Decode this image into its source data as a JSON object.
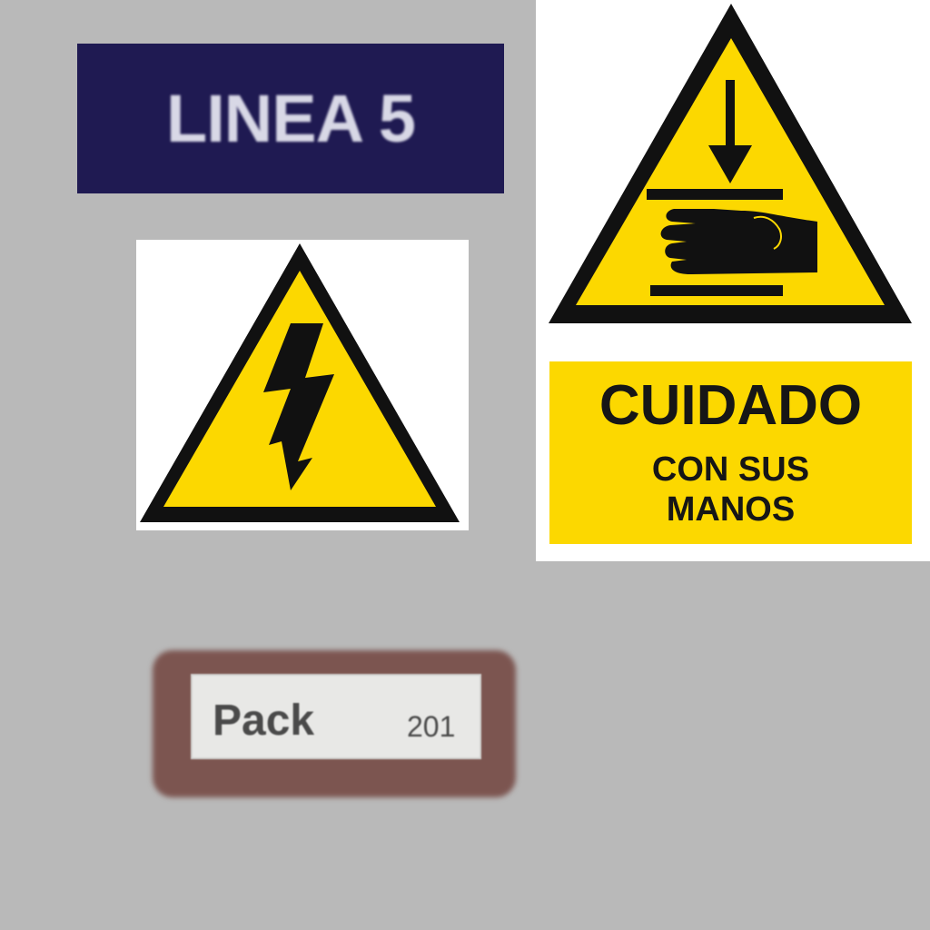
{
  "linea_sign": {
    "text": "LINEA 5",
    "color": "#1f1a52"
  },
  "electric_sign": {
    "icon": "high-voltage-icon",
    "color": "#fcd800"
  },
  "hand_sign": {
    "icon": "hand-crush-icon",
    "title": "CUIDADO",
    "line1": "CON SUS",
    "line2": "MANOS",
    "color": "#fcd800"
  },
  "pack_label": {
    "word": "Pack",
    "number": "201"
  }
}
